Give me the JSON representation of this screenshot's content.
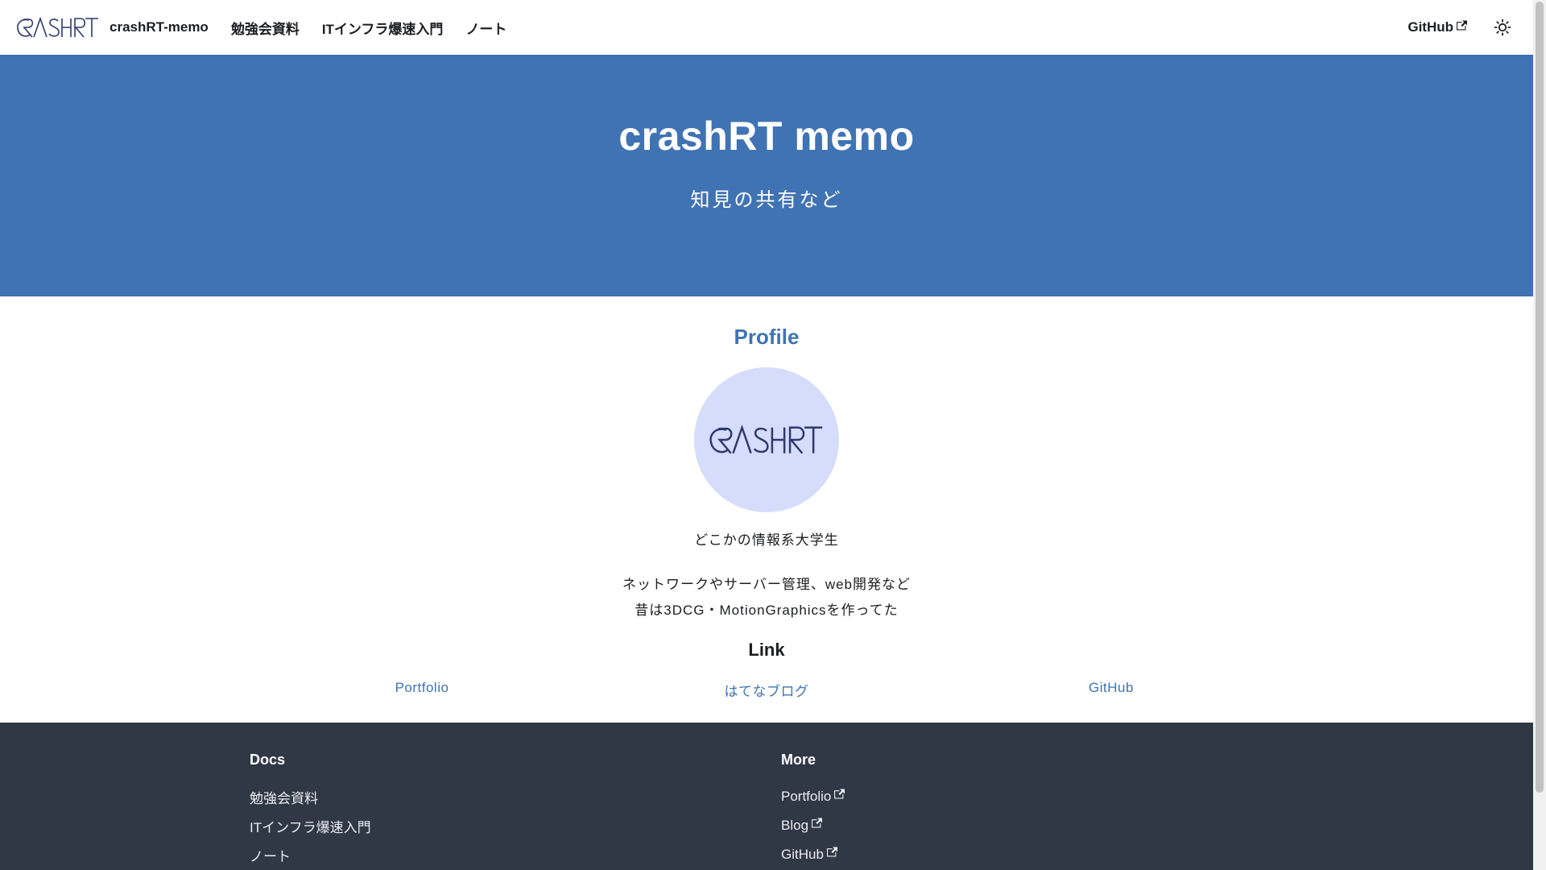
{
  "navbar": {
    "logo_text": "CRASHRT",
    "site_title": "crashRT-memo",
    "links": [
      {
        "label": "勉強会資料"
      },
      {
        "label": "ITインフラ爆速入門"
      },
      {
        "label": "ノート"
      }
    ],
    "github_label": "GitHub",
    "theme_toggle_icon": "sun-icon"
  },
  "hero": {
    "title": "crashRT memo",
    "subtitle": "知見の共有など"
  },
  "profile": {
    "heading": "Profile",
    "avatar_text": "CRASHRT",
    "affiliation": "どこかの情報系大学生",
    "bio": [
      "ネットワークやサーバー管理、web開発など",
      "昔は3DCG・MotionGraphicsを作ってた"
    ]
  },
  "links": {
    "heading": "Link",
    "items": [
      {
        "label": "Portfolio"
      },
      {
        "label": "はてなブログ"
      },
      {
        "label": "GitHub"
      }
    ]
  },
  "footer": {
    "docs": {
      "title": "Docs",
      "items": [
        "勉強会資料",
        "ITインフラ爆速入門",
        "ノート"
      ]
    },
    "more": {
      "title": "More",
      "items": [
        "Portfolio",
        "Blog",
        "GitHub"
      ]
    }
  },
  "colors": {
    "primary": "#4073b3",
    "footer_bg": "#303846",
    "avatar_bg": "#d6dcfb",
    "logo_stroke": "#2c3a6e"
  }
}
